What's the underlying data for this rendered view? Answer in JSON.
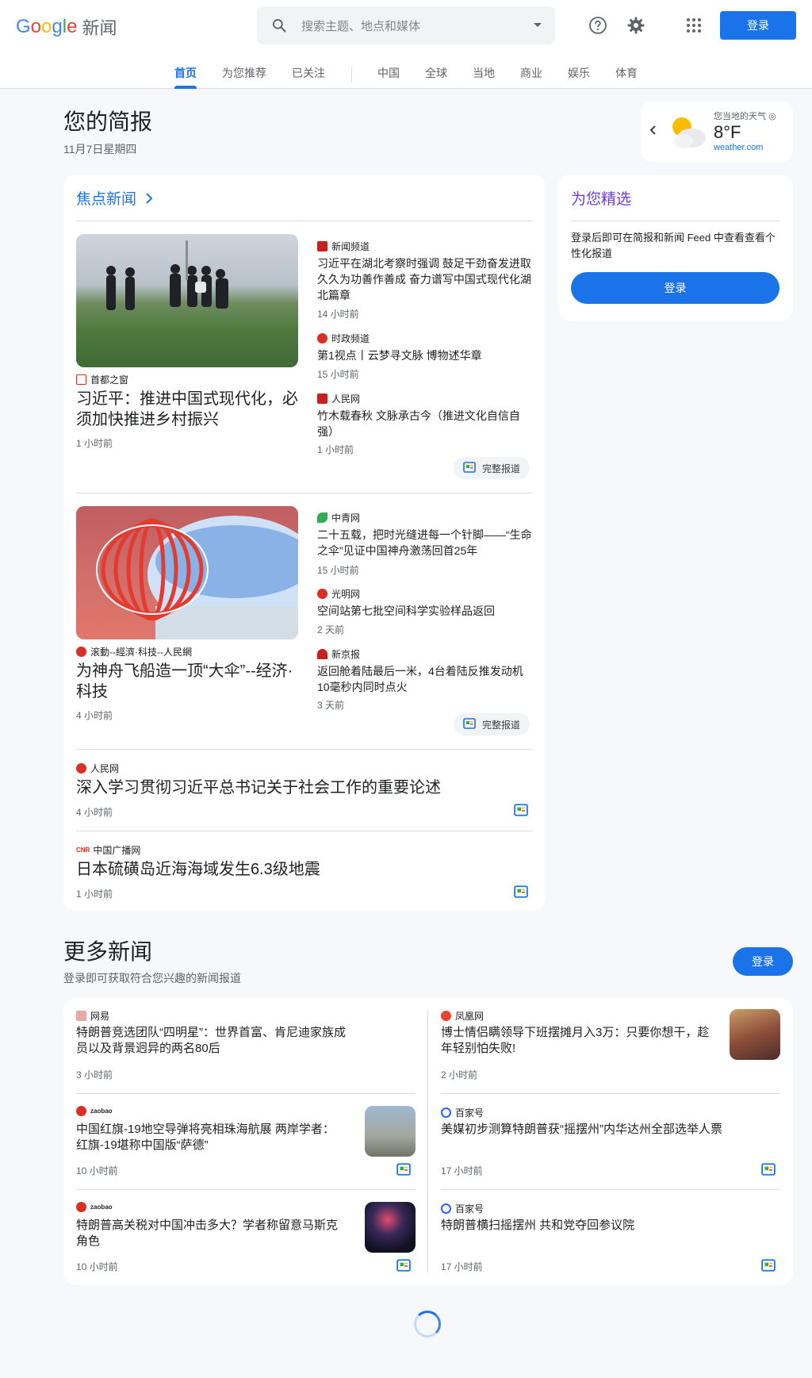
{
  "header": {
    "logo_google": [
      "G",
      "o",
      "o",
      "g",
      "l",
      "e"
    ],
    "logo_news": "新闻",
    "search_placeholder": "搜索主题、地点和媒体",
    "signin_label": "登录",
    "icons": [
      "search-icon",
      "chevron-down-icon",
      "help-icon",
      "gear-icon",
      "apps-icon"
    ]
  },
  "tabs": [
    "首页",
    "为您推荐",
    "已关注",
    "中国",
    "全球",
    "当地",
    "商业",
    "娱乐",
    "体育"
  ],
  "briefing": {
    "title": "您的简报",
    "date": "11月7日星期四"
  },
  "weather": {
    "label": "您当地的天气",
    "temp": "8°F",
    "source": "weather.com"
  },
  "top_stories": {
    "title": "焦点新闻",
    "full_coverage": "完整报道",
    "clusters": [
      {
        "main": {
          "source": "首都之窗",
          "title": "习近平：推进中国式现代化，必须加快推进乡村振兴",
          "time": "1 小时前"
        },
        "related": [
          {
            "source": "新闻频道",
            "title": "习近平在湖北考察时强调 鼓足干劲奋发进取 久久为功善作善成 奋力谱写中国式现代化湖北篇章",
            "time": "14 小时前"
          },
          {
            "source": "时政频道",
            "title": "第1视点丨云梦寻文脉 博物述华章",
            "time": "15 小时前"
          },
          {
            "source": "人民网",
            "title": "竹木载春秋 文脉承古今（推进文化自信自强）",
            "time": "1 小时前"
          }
        ]
      },
      {
        "main": {
          "source": "滚動--經濟·科技--人民網",
          "title": "为神舟飞船造一顶“大伞”--经济·科技",
          "time": "4 小时前"
        },
        "related": [
          {
            "source": "中青网",
            "title": "二十五载，把时光缝进每一个针脚——“生命之伞”见证中国神舟激荡回首25年",
            "time": "15 小时前"
          },
          {
            "source": "光明网",
            "title": "空间站第七批空间科学实验样品返回",
            "time": "2 天前"
          },
          {
            "source": "新京报",
            "title": "返回舱着陆最后一米，4台着陆反推发动机10毫秒内同时点火",
            "time": "3 天前"
          }
        ]
      }
    ],
    "singles": [
      {
        "source": "人民网",
        "title": "深入学习贯彻习近平总书记关于社会工作的重要论述",
        "time": "4 小时前"
      },
      {
        "source": "中国广播网",
        "source_badge": "CNR",
        "title": "日本硫磺岛近海海域发生6.3级地震",
        "time": "1 小时前"
      }
    ]
  },
  "picks": {
    "title": "为您精选",
    "text": "登录后即可在简报和新闻 Feed 中查看查看个性化报道",
    "button": "登录"
  },
  "more_news": {
    "title": "更多新闻",
    "subtitle": "登录即可获取符合您兴趣的新闻报道",
    "button": "登录",
    "left": [
      {
        "source": "网易",
        "title": "特朗普竞选团队“四明星”：世界首富、肯尼迪家族成员以及背景迥异的两名80后",
        "time": "3 小时前"
      },
      {
        "source": "zaobao",
        "title": "中国红旗-19地空导弹将亮相珠海航展 两岸学者：红旗-19堪称中国版“萨德”",
        "time": "10 小时前"
      },
      {
        "source": "zaobao",
        "title": "特朗普高关税对中国冲击多大？学者称留意马斯克角色",
        "time": "10 小时前"
      }
    ],
    "right": [
      {
        "source": "凤凰网",
        "title": "博士情侣瞒领导下班摆摊月入3万：只要你想干，趁年轻别怕失败!",
        "time": "2 小时前"
      },
      {
        "source": "百家号",
        "title": "美媒初步测算特朗普获“摇摆州”内华达州全部选举人票",
        "time": "17 小时前"
      },
      {
        "source": "百家号",
        "title": "特朗普横扫摇摆州 共和党夺回参议院",
        "time": "17 小时前"
      }
    ]
  },
  "colors": {
    "accent": "#1a73e8",
    "picks_title": "#6c3cd6",
    "background": "#f6f8fc"
  }
}
